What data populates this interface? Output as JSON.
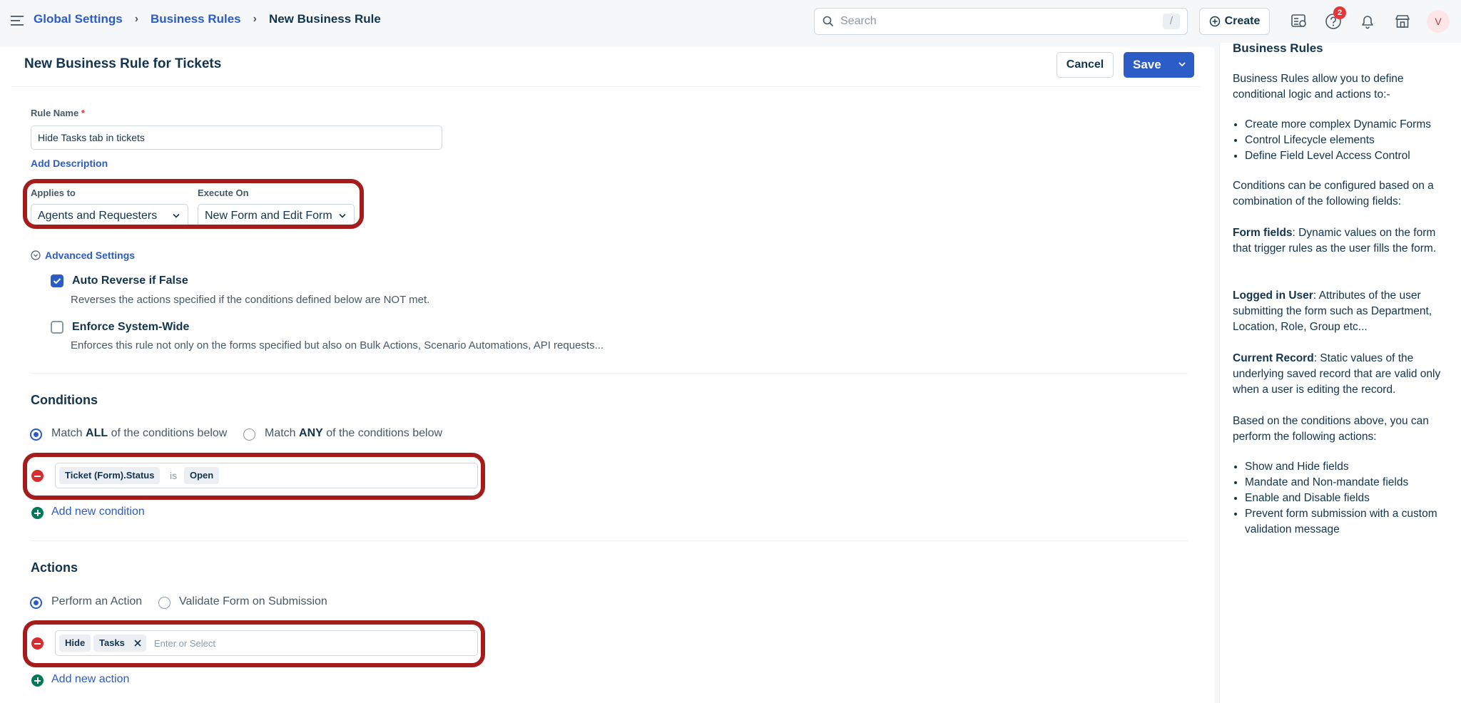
{
  "header": {
    "breadcrumbs": [
      "Global Settings",
      "Business Rules",
      "New Business Rule"
    ],
    "search_placeholder": "Search",
    "search_shortcut": "/",
    "create_label": "Create",
    "help_badge_count": "2",
    "avatar_initial": "V"
  },
  "form": {
    "title": "New Business Rule for Tickets",
    "cancel_label": "Cancel",
    "save_label": "Save",
    "rule_name_label": "Rule Name",
    "rule_name_required": "*",
    "rule_name_value": "Hide Tasks tab in tickets",
    "add_description_label": "Add Description",
    "applies_to_label": "Applies to",
    "applies_to_value": "Agents and Requesters",
    "execute_on_label": "Execute On",
    "execute_on_value": "New Form and Edit Form",
    "advanced_settings_label": "Advanced Settings",
    "auto_reverse": {
      "title": "Auto Reverse if False",
      "description": "Reverses the actions specified if the conditions defined below are NOT met.",
      "checked": true
    },
    "enforce_system_wide": {
      "title": "Enforce System-Wide",
      "description": "Enforces this rule not only on the forms specified but also on Bulk Actions, Scenario Automations, API requests...",
      "checked": false
    }
  },
  "conditions": {
    "title": "Conditions",
    "match_all": {
      "prefix": "Match ",
      "emphasis": "ALL",
      "suffix": " of the conditions below",
      "selected": true
    },
    "match_any": {
      "prefix": "Match ",
      "emphasis": "ANY",
      "suffix": " of the conditions below",
      "selected": false
    },
    "rows": [
      {
        "field": "Ticket (Form).Status",
        "operator": "is",
        "value": "Open"
      }
    ],
    "add_label": "Add new condition"
  },
  "actions": {
    "title": "Actions",
    "perform_label": "Perform an Action",
    "validate_label": "Validate Form on Submission",
    "perform_selected": true,
    "rows": [
      {
        "action": "Hide",
        "target": "Tasks",
        "input_placeholder": "Enter or Select"
      }
    ],
    "add_label": "Add new action"
  },
  "help_panel": {
    "title": "Business Rules",
    "intro": "Business Rules allow you to define conditional logic and actions to:-",
    "intro_list": [
      "Create more complex Dynamic Forms",
      "Control Lifecycle elements",
      "Define Field Level Access Control"
    ],
    "conditions_text": "Conditions can be configured based on a combination of the following fields:",
    "form_fields_term": "Form fields",
    "form_fields_text": ": Dynamic values on the form that trigger rules as the user fills the form.",
    "logged_in_term": "Logged in User",
    "logged_in_text": ": Attributes of the user submitting the form such as Department, Location, Role, Group etc...",
    "current_record_term": "Current Record",
    "current_record_text": ": Static values of the underlying saved record that are valid only when a user is editing the record.",
    "actions_text": "Based on the conditions above, you can perform the following actions:",
    "actions_list": [
      "Show and Hide fields",
      "Mandate and Non-mandate fields",
      "Enable and Disable fields",
      "Prevent form submission with a custom validation message"
    ]
  }
}
